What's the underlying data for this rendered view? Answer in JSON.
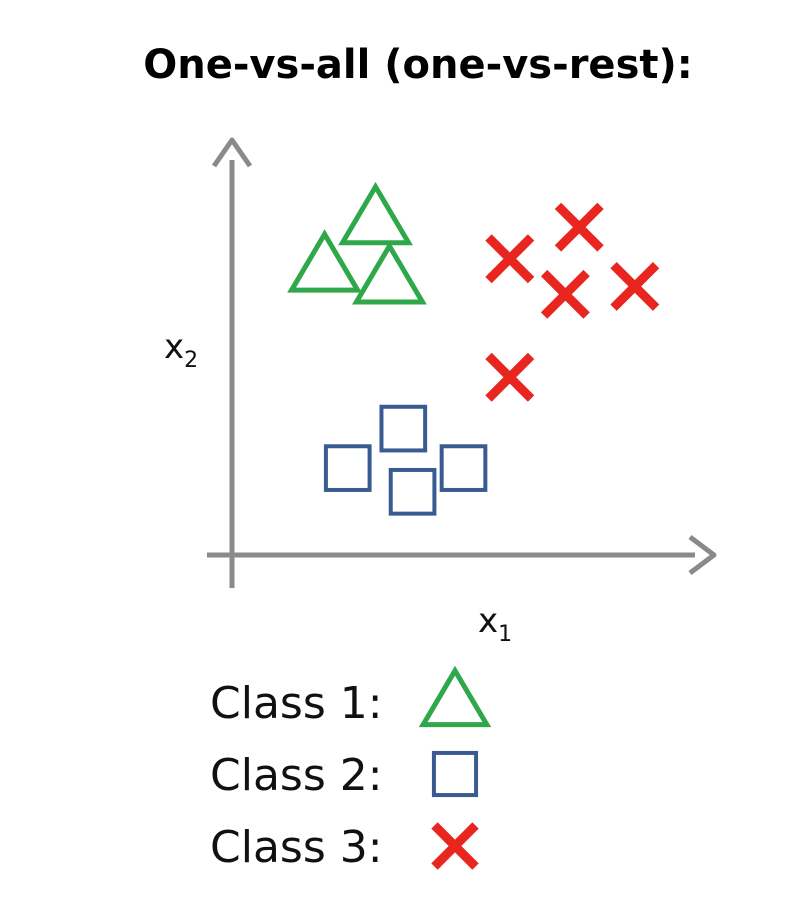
{
  "chart_data": {
    "type": "scatter",
    "title": "One-vs-all (one-vs-rest):",
    "xlabel": {
      "base": "x",
      "sub": "1"
    },
    "ylabel": {
      "base": "x",
      "sub": "2"
    },
    "grid": false,
    "xlim": [
      0,
      10
    ],
    "ylim": [
      0,
      10
    ],
    "axis_color": "#8a8a8a",
    "series": [
      {
        "name": "Class 1:",
        "marker": "triangle",
        "color": "#2ea84a",
        "points": [
          [
            3.1,
            8.5
          ],
          [
            2.0,
            7.3
          ],
          [
            3.4,
            7.0
          ]
        ]
      },
      {
        "name": "Class 2:",
        "marker": "square",
        "color": "#3a5b92",
        "points": [
          [
            3.7,
            3.2
          ],
          [
            2.5,
            2.2
          ],
          [
            3.9,
            1.6
          ],
          [
            5.0,
            2.2
          ]
        ]
      },
      {
        "name": "Class 3:",
        "marker": "cross",
        "color": "#e8261f",
        "points": [
          [
            7.5,
            8.3
          ],
          [
            6.0,
            7.5
          ],
          [
            7.2,
            6.6
          ],
          [
            8.7,
            6.8
          ],
          [
            6.0,
            4.5
          ]
        ]
      }
    ],
    "legend": "bottom"
  }
}
